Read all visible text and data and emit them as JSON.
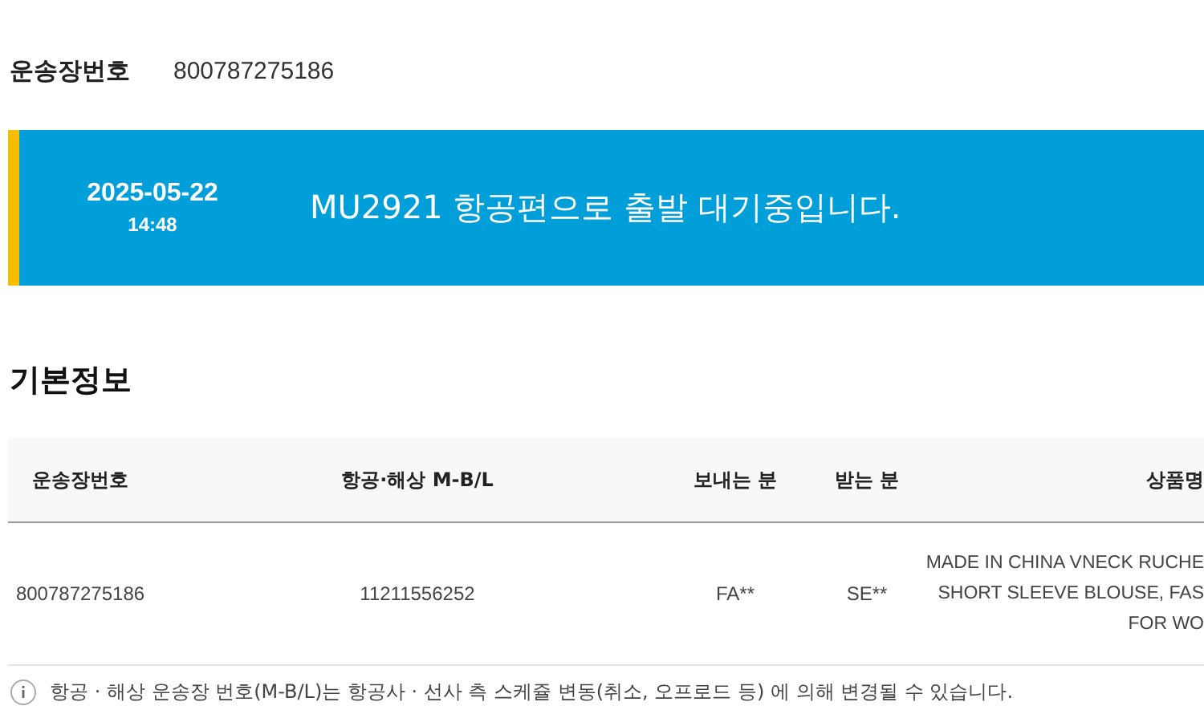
{
  "waybill": {
    "label": "운송장번호",
    "value": "800787275186"
  },
  "status_banner": {
    "date": "2025-05-22",
    "time": "14:48",
    "message": "MU2921 항공편으로 출발 대기중입니다."
  },
  "section_title": "기본정보",
  "table": {
    "columns": [
      "운송장번호",
      "항공·해상 M-B/L",
      "보내는 분",
      "받는 분",
      "상품명"
    ],
    "rows": [
      {
        "waybill": "800787275186",
        "mbl": "11211556252",
        "sender": "FA**",
        "receiver": "SE**",
        "product": [
          "MADE IN CHINA VNECK RUCHE",
          "SHORT SLEEVE BLOUSE, FAS",
          "FOR WO"
        ]
      }
    ]
  },
  "notice": "항공 · 해상 운송장 번호(M-B/L)는 항공사 · 선사 측 스케쥴 변동(취소, 오프로드 등) 에 의해 변경될 수 있습니다."
}
